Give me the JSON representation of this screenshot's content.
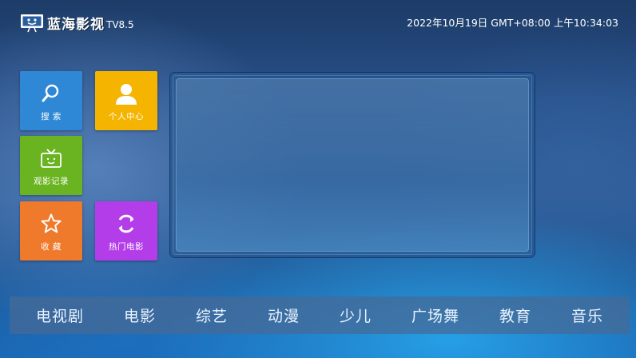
{
  "header": {
    "app_name": "蓝海影视",
    "version": "TV8.5",
    "datetime": "2022年10月19日 GMT+08:00 上午10:34:03"
  },
  "tiles": [
    {
      "label": "搜  索",
      "icon": "search-icon",
      "color": "#2e88d6"
    },
    {
      "label": "个人中心",
      "icon": "user-icon",
      "color": "#f5b400"
    },
    {
      "label": "观影记录",
      "icon": "tv-history-icon",
      "color": "#6ab321"
    },
    {
      "label": "收  藏",
      "icon": "star-icon",
      "color": "#f07a2c"
    },
    {
      "label": "热门电影",
      "icon": "refresh-icon",
      "color": "#b33ee9"
    }
  ],
  "categories": [
    "电视剧",
    "电影",
    "综艺",
    "动漫",
    "少儿",
    "广场舞",
    "教育",
    "音乐"
  ]
}
